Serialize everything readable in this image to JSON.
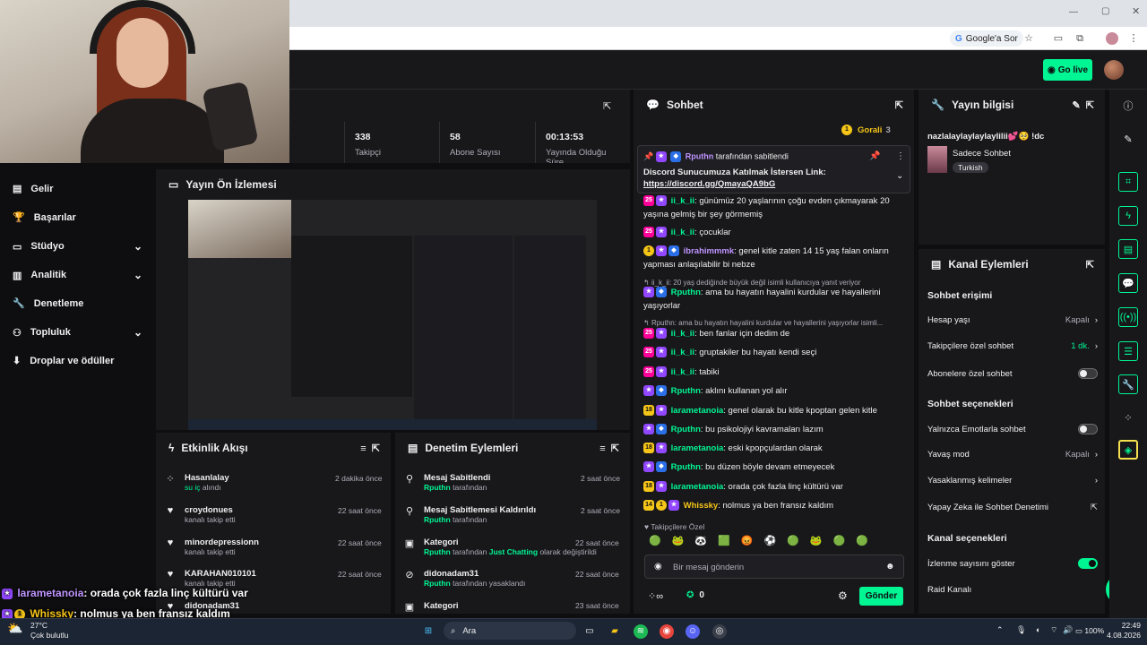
{
  "browser": {
    "google_label": "Google'a Sor"
  },
  "header": {
    "go_live_label": "Go live"
  },
  "stats": [
    {
      "value": "338",
      "label": "Takipçi"
    },
    {
      "value": "58",
      "label": "Abone Sayısı"
    },
    {
      "value": "00:13:53",
      "label": "Yayında Olduğu Süre"
    }
  ],
  "left_nav": [
    {
      "label": "Gelir",
      "icon": "revenue-icon",
      "chevron": false
    },
    {
      "label": "Başarılar",
      "icon": "trophy-icon",
      "chevron": false
    },
    {
      "label": "Stüdyo",
      "icon": "studio-icon",
      "chevron": true
    },
    {
      "label": "Analitik",
      "icon": "analytics-icon",
      "chevron": true
    },
    {
      "label": "Denetleme",
      "icon": "wrench-icon",
      "chevron": false
    },
    {
      "label": "Topluluk",
      "icon": "community-icon",
      "chevron": true
    },
    {
      "label": "Droplar ve ödüller",
      "icon": "drops-icon",
      "chevron": false
    }
  ],
  "preview": {
    "title": "Yayın Ön İzlemesi"
  },
  "chat": {
    "title": "Sohbet",
    "goral": {
      "label": "Gorali",
      "count": "3"
    },
    "pinned": {
      "by_user": "Rputhn",
      "by_suffix": "tarafından sabitlendi",
      "text": "Discord Sunucumuza Katılmak İstersen Link:",
      "link": "https://discord.gg/QmayaQA9bG"
    },
    "messages": [
      {
        "badges": [
          "sub25",
          "star"
        ],
        "user": "ii_k_ii",
        "color": "#00f593",
        "text": "günümüz 20 yaşlarının çoğu evden çıkmayarak 20 yaşına gelmiş bir şey görmemiş"
      },
      {
        "badges": [
          "sub25",
          "star"
        ],
        "user": "ii_k_ii",
        "color": "#00f593",
        "text": "çocuklar"
      },
      {
        "badges": [
          "gold",
          "star",
          "vip"
        ],
        "user": "ibrahimmmk",
        "color": "#bf94ff",
        "text": "genel kitle zaten 14 15 yaş falan onların yapması anlaşılabilir bi nebze"
      },
      {
        "badges": [],
        "user": "",
        "color": "#adadb8",
        "text": "ii_k_ii: 20 yaş dediğinde büyük değil isimli kullanıcıya yanıt veriyor",
        "reply": true
      },
      {
        "badges": [
          "star",
          "vip"
        ],
        "user": "Rputhn",
        "color": "#00f593",
        "text": "ama bu hayatın hayalini kurdular ve hayallerini yaşıyorlar"
      },
      {
        "badges": [],
        "user": "",
        "color": "#adadb8",
        "text": "Rputhn: ama bu hayatın hayalini kurdular ve hayallerini yaşıyorlar isimli...",
        "reply": true
      },
      {
        "badges": [
          "sub25",
          "star"
        ],
        "user": "ii_k_ii",
        "color": "#00f593",
        "text": "ben fanlar için dedim de"
      },
      {
        "badges": [
          "sub25",
          "star"
        ],
        "user": "ii_k_ii",
        "color": "#00f593",
        "text": "gruptakiler bu hayatı kendi seçi"
      },
      {
        "badges": [
          "sub25",
          "star"
        ],
        "user": "ii_k_ii",
        "color": "#00f593",
        "text": "tabiki"
      },
      {
        "badges": [
          "star",
          "vip"
        ],
        "user": "Rputhn",
        "color": "#00f593",
        "text": "aklını kullanan yol alır"
      },
      {
        "badges": [
          "num18",
          "star"
        ],
        "user": "larametanoia",
        "color": "#00f593",
        "text": "genel olarak bu kitle kpoptan gelen kitle"
      },
      {
        "badges": [
          "star",
          "vip"
        ],
        "user": "Rputhn",
        "color": "#00f593",
        "text": "bu psikolojiyi kavramaları lazım"
      },
      {
        "badges": [
          "num18",
          "star"
        ],
        "user": "larametanoia",
        "color": "#00f593",
        "text": "eski kpopçulardan olarak"
      },
      {
        "badges": [
          "star",
          "vip"
        ],
        "user": "Rputhn",
        "color": "#00f593",
        "text": "bu düzen böyle devam etmeyecek"
      },
      {
        "badges": [
          "num18",
          "star"
        ],
        "user": "larametanoia",
        "color": "#00f593",
        "text": "orada çok fazla linç kültürü var"
      },
      {
        "badges": [
          "num14",
          "gold",
          "star"
        ],
        "user": "Whissky",
        "color": "#f5c518",
        "text": "nolmus ya ben fransız kaldım"
      }
    ],
    "followers_only": "Takipçilere Özel",
    "input_placeholder": "Bir mesaj gönderin",
    "points_value": "0",
    "send_label": "Gönder"
  },
  "stream_info": {
    "title": "Yayın bilgisi",
    "stream_title": "nazlalaylaylaylaylilii💕🥺 !dc",
    "category": "Sadece Sohbet",
    "tag": "Turkish"
  },
  "channel_actions": {
    "title": "Kanal Eylemleri",
    "chat_access": "Sohbet erişimi",
    "account_age": {
      "label": "Hesap yaşı",
      "value": "Kapalı"
    },
    "followers_chat": {
      "label": "Takipçilere özel sohbet",
      "value": "1 dk."
    },
    "subs_chat": {
      "label": "Abonelere özel sohbet"
    },
    "chat_options": "Sohbet seçenekleri",
    "emote_only": {
      "label": "Yalnızca Emotlarla sohbet"
    },
    "slow_mode": {
      "label": "Yavaş mod",
      "value": "Kapalı"
    },
    "blocked_terms": {
      "label": "Yasaklanmış kelimeler"
    },
    "ai_moderation": {
      "label": "Yapay Zeka ile Sohbet Denetimi"
    },
    "channel_options": "Kanal seçenekleri",
    "view_count": {
      "label": "İzlenme sayısını göster"
    },
    "raid": {
      "label": "Raid Kanalı"
    }
  },
  "activity_feed": {
    "title": "Etkinlik Akışı",
    "items": [
      {
        "user": "Hasanlalay",
        "detail_green": "su iç",
        "detail": " alındı",
        "time": "2 dakika önce",
        "icon": "reward-icon"
      },
      {
        "user": "croydonues",
        "detail_green": "",
        "detail": "kanalı takip etti",
        "time": "22 saat önce",
        "icon": "heart-icon"
      },
      {
        "user": "minordepressionn",
        "detail_green": "",
        "detail": "kanalı takip etti",
        "time": "22 saat önce",
        "icon": "heart-icon"
      },
      {
        "user": "KARAHAN010101",
        "detail_green": "",
        "detail": "kanalı takip etti",
        "time": "22 saat önce",
        "icon": "heart-icon"
      },
      {
        "user": "didonadam31",
        "detail_green": "",
        "detail": "",
        "time": "",
        "icon": "heart-icon"
      }
    ]
  },
  "mod_actions": {
    "title": "Denetim Eylemleri",
    "items": [
      {
        "action": "Mesaj Sabitlendi",
        "by": "Rputhn",
        "suffix": " tarafından",
        "extra": "",
        "extra2": "",
        "time": "2 saat önce",
        "icon": "pin-icon"
      },
      {
        "action": "Mesaj Sabitlemesi Kaldırıldı",
        "by": "Rputhn",
        "suffix": " tarafından",
        "extra": "",
        "extra2": "",
        "time": "2 saat önce",
        "icon": "unpin-icon"
      },
      {
        "action": "Kategori",
        "by": "Rputhn",
        "suffix": " tarafından ",
        "extra": "Just Chatting",
        "extra2": " olarak değiştirildi",
        "time": "22 saat önce",
        "icon": "category-icon"
      },
      {
        "action": "didonadam31",
        "by": "Rputhn",
        "suffix": " tarafından yasaklandı",
        "extra": "",
        "extra2": "",
        "time": "22 saat önce",
        "icon": "ban-icon"
      },
      {
        "action": "Kategori",
        "by": "",
        "suffix": "",
        "extra": "",
        "extra2": "",
        "time": "23 saat önce",
        "icon": "category-icon"
      }
    ]
  },
  "overlay_chat": [
    {
      "user": "larametanoia",
      "text": ": orada çok fazla linç kültürü var",
      "color": "#bf94ff"
    },
    {
      "user": "Whissky",
      "text": ": nolmus ya ben fransız kaldım",
      "color": "#f5c518"
    }
  ],
  "taskbar": {
    "weather_temp": "27°C",
    "weather_desc": "Çok bulutlu",
    "search_label": "Ara",
    "battery": "100%",
    "time": "22:49",
    "date": "4.08.2026"
  }
}
